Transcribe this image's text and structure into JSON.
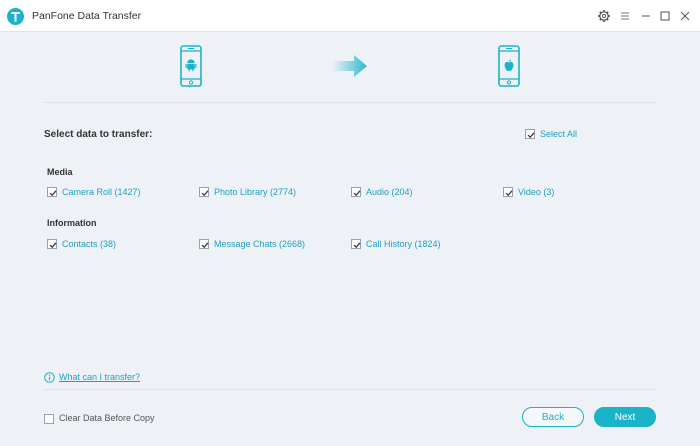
{
  "window": {
    "title": "PanFone Data Transfer",
    "controls": [
      "gear-icon",
      "menu-icon",
      "minimize-icon",
      "maximize-icon",
      "close-icon"
    ]
  },
  "devices": {
    "source": "android-phone-icon",
    "target": "apple-phone-icon",
    "accent": "#1bb3c8"
  },
  "selection": {
    "title": "Select data to transfer:",
    "select_all": {
      "label": "Select All",
      "checked": true
    }
  },
  "media": {
    "title": "Media",
    "items": [
      {
        "label": "Camera Roll (1427)",
        "checked": true
      },
      {
        "label": "Photo Library (2774)",
        "checked": true
      },
      {
        "label": "Audio (204)",
        "checked": true
      },
      {
        "label": "Video (3)",
        "checked": true
      }
    ]
  },
  "information": {
    "title": "Information",
    "items": [
      {
        "label": "Contacts (38)",
        "checked": true
      },
      {
        "label": "Message Chats (2668)",
        "checked": true
      },
      {
        "label": "Call History (1824)",
        "checked": true
      }
    ]
  },
  "footer": {
    "help_link": "What can I transfer?",
    "clear_data": {
      "label": "Clear Data Before Copy",
      "checked": false
    },
    "back_label": "Back",
    "next_label": "Next"
  }
}
